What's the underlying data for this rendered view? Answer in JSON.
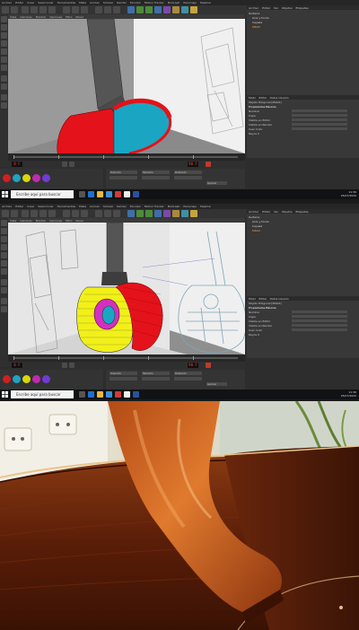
{
  "app": {
    "menu": [
      "Archivo",
      "Editar",
      "Crear",
      "Seleccionar",
      "Herramientas",
      "Malla",
      "Animar",
      "Simular",
      "Render",
      "Esculpir",
      "Motion Tracker",
      "MoGraph",
      "Personaje",
      "Pipeline",
      "Plugins",
      "Script",
      "Ventana",
      "Ayuda"
    ],
    "viewport_menu": [
      "Vista",
      "Cámaras",
      "Mostrar",
      "Opciones",
      "Filtro",
      "Panel"
    ],
    "panel_tabs": [
      "Archivo",
      "Editar",
      "Ver",
      "Objetos",
      "Etiquetas",
      "Marcadores"
    ],
    "objects": [
      "Guitarra",
      "Aros y fondo",
      "Cejuela",
      "Mástil",
      "Diapasón"
    ],
    "attributes": {
      "tabs": [
        "Modo",
        "Editar",
        "Datos Usuario"
      ],
      "title": "Objeto Poligonal [Mástil]",
      "tab_basic": "Básico",
      "tab_coord": "Coord.",
      "tab_phong": "Phong",
      "section": "Propiedades Básicas",
      "rows": [
        {
          "label": "Nombre",
          "value": "Mástil"
        },
        {
          "label": "Capa",
          "value": ""
        },
        {
          "label": "Visible en Editor",
          "value": "Por Defecto"
        },
        {
          "label": "Visible en Render",
          "value": "Por Defecto"
        },
        {
          "label": "Usar Color",
          "value": "Desactivado"
        },
        {
          "label": "Color de Visual.",
          "value": ""
        },
        {
          "label": "Rayos X",
          "value": ""
        }
      ]
    },
    "frame_counter": "0 F",
    "frame_end": "90 F",
    "coords": {
      "headers": [
        "Posición",
        "Tamaño",
        "Rotación"
      ],
      "apply_button": "Aplicar",
      "mode": "Objeto (Rel)"
    },
    "materials": [
      {
        "name": "Mat",
        "color": "#d02020"
      },
      {
        "name": "Mat.1",
        "color": "#1fa3c4"
      },
      {
        "name": "Mat.2",
        "color": "#d6d80a"
      },
      {
        "name": "Mat.3",
        "color": "#c02ab0"
      },
      {
        "name": "Mat.4",
        "color": "#6f3bd6"
      }
    ]
  },
  "taskbar": {
    "search_placeholder": "Escribe aquí para buscar",
    "time": "11:36",
    "date": "25/07/2020",
    "lang": "ESP"
  },
  "colors": {
    "body_red": "#e4121a",
    "body_cyan": "#1aa6c3",
    "body_yellow": "#f1f01a",
    "rosette_magenta": "#d42fbf",
    "neck_gray": "#5b5b5b",
    "wood_dark": "#5a1e08",
    "wood_orange": "#c2571f"
  }
}
